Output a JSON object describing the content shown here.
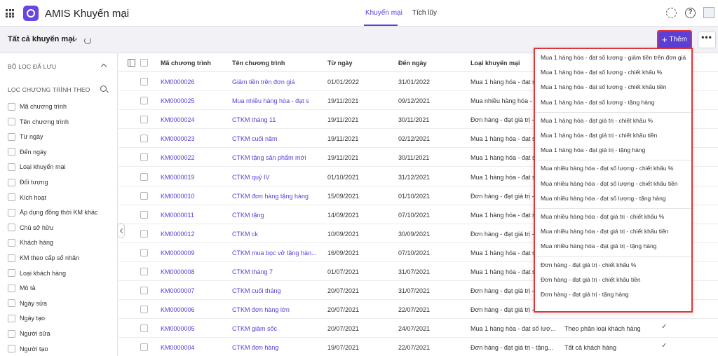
{
  "app": {
    "title": "AMIS Khuyến mại"
  },
  "nav": {
    "tabs": [
      "Khuyến mại",
      "Tích lũy"
    ]
  },
  "toolbar": {
    "view_title": "Tất cả khuyến mại",
    "add_label": "Thêm",
    "more_label": "•••"
  },
  "sidebar": {
    "saved_filters": "BỘ LỌC ĐÃ LƯU",
    "filter_by": "LỌC CHƯƠNG TRÌNH THEO",
    "items": [
      "Mã chương trình",
      "Tên chương trình",
      "Từ ngày",
      "Đến ngày",
      "Loại khuyến mại",
      "Đối tượng",
      "Kích hoạt",
      "Áp dụng đồng thời KM khác",
      "Chủ sở hữu",
      "Khách hàng",
      "KM theo cấp số nhân",
      "Loại khách hàng",
      "Mô tả",
      "Ngày sửa",
      "Ngày tạo",
      "Người sửa",
      "Người tạo"
    ]
  },
  "table": {
    "columns": [
      "Mã chương trình",
      "Tên chương trình",
      "Từ ngày",
      "Đến ngày",
      "Loại khuyến mại"
    ],
    "rows": [
      {
        "code": "KM0000026",
        "name": "Giảm tiền trên đơn giá",
        "from": "01/01/2022",
        "to": "31/01/2022",
        "type": "Mua 1 hàng hóa - đạt s",
        "target": "",
        "check": ""
      },
      {
        "code": "KM0000025",
        "name": "Mua nhiều hàng hóa - đạt s",
        "from": "19/11/2021",
        "to": "09/12/2021",
        "type": "Mua nhiều hàng hóa - đạt",
        "target": "",
        "check": ""
      },
      {
        "code": "KM0000024",
        "name": "CTKM tháng 11",
        "from": "19/11/2021",
        "to": "30/11/2021",
        "type": "Đơn hàng - đạt giá trị - t",
        "target": "",
        "check": ""
      },
      {
        "code": "KM0000023",
        "name": "CTKM cuối năm",
        "from": "19/11/2021",
        "to": "02/12/2021",
        "type": "Mua 1 hàng hóa - đạt s",
        "target": "",
        "check": ""
      },
      {
        "code": "KM0000022",
        "name": "CTKM tặng sản phẩm mới",
        "from": "19/11/2021",
        "to": "30/11/2021",
        "type": "Mua 1 hàng hóa - đạt s",
        "target": "",
        "check": ""
      },
      {
        "code": "KM0000019",
        "name": "CTKM quý IV",
        "from": "01/10/2021",
        "to": "31/12/2021",
        "type": "Mua 1 hàng hóa - đạt s",
        "target": "",
        "check": ""
      },
      {
        "code": "KM0000010",
        "name": "CTKM đơn hàng tặng hàng",
        "from": "15/09/2021",
        "to": "01/10/2021",
        "type": "Đơn hàng - đạt giá trị - t",
        "target": "",
        "check": ""
      },
      {
        "code": "KM0000011",
        "name": "CTKM tặng",
        "from": "14/09/2021",
        "to": "07/10/2021",
        "type": "Mua 1 hàng hóa - đạt s",
        "target": "",
        "check": ""
      },
      {
        "code": "KM0000012",
        "name": "CTKM ck",
        "from": "10/09/2021",
        "to": "30/09/2021",
        "type": "Đơn hàng - đạt giá trị - t",
        "target": "",
        "check": ""
      },
      {
        "code": "KM0000009",
        "name": "CTKM mua bọc vở tặng hàn...",
        "from": "16/09/2021",
        "to": "07/10/2021",
        "type": "Mua 1 hàng hóa - đạt s",
        "target": "",
        "check": ""
      },
      {
        "code": "KM0000008",
        "name": "CTKM tháng 7",
        "from": "01/07/2021",
        "to": "31/07/2021",
        "type": "Mua 1 hàng hóa - đạt s",
        "target": "",
        "check": ""
      },
      {
        "code": "KM0000007",
        "name": "CTKM cuối tháng",
        "from": "20/07/2021",
        "to": "31/07/2021",
        "type": "Đơn hàng - đạt giá trị - t",
        "target": "",
        "check": ""
      },
      {
        "code": "KM0000006",
        "name": "CTKM đơn hàng lớn",
        "from": "20/07/2021",
        "to": "22/07/2021",
        "type": "Đơn hàng - đạt giá trị - t",
        "target": "",
        "check": ""
      },
      {
        "code": "KM0000005",
        "name": "CTKM giảm sốc",
        "from": "20/07/2021",
        "to": "24/07/2021",
        "type": "Mua 1 hàng hóa - đạt số lượ...",
        "target": "Theo phân loại khách hàng",
        "check": "✓"
      },
      {
        "code": "KM0000004",
        "name": "CTKM đơn hàng",
        "from": "19/07/2021",
        "to": "22/07/2021",
        "type": "Đơn hàng - đạt giá trị - tặng...",
        "target": "Tất cả khách hàng",
        "check": "✓"
      }
    ]
  },
  "dropdown": {
    "groups": [
      [
        "Mua 1 hàng hóa - đạt số lượng - giảm tiền trên đơn giá",
        "Mua 1 hàng hóa - đạt số lượng - chiết khấu %",
        "Mua 1 hàng hóa - đạt số lượng - chiết khấu tiền",
        "Mua 1 hàng hóa - đạt số lượng - tặng hàng"
      ],
      [
        "Mua 1 hàng hóa - đạt giá trị - chiết khấu %",
        "Mua 1 hàng hóa - đạt giá trị - chiết khấu tiền",
        "Mua 1 hàng hóa - đạt giá trị - tặng hàng"
      ],
      [
        "Mua nhiều hàng hóa - đạt số lượng - chiết khấu %",
        "Mua nhiều hàng hóa - đạt số lượng - chiết khấu tiền",
        "Mua nhiều hàng hóa - đạt số lượng - tặng hàng"
      ],
      [
        "Mua nhiều hàng hóa - đạt giá trị - chiết khấu %",
        "Mua nhiều hàng hóa - đạt giá trị - chiết khấu tiền",
        "Mua nhiều hàng hóa - đạt giá trị - tặng hàng"
      ],
      [
        "Đơn hàng - đạt giá trị - chiết khấu %",
        "Đơn hàng - đạt giá trị - chiết khấu tiền",
        "Đơn hàng - đạt giá trị - tặng hàng"
      ]
    ]
  },
  "icons": {
    "apps": "grid-icon",
    "logo": "amis-logo-icon",
    "settings": "gear-icon",
    "help": "help-icon",
    "refresh": "refresh-icon",
    "search": "search-icon"
  },
  "colors": {
    "accent": "#5b3fd6",
    "highlight": "#e0343a"
  }
}
